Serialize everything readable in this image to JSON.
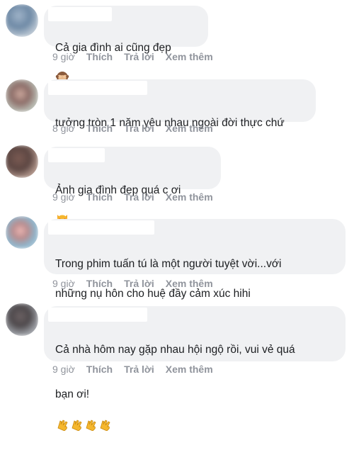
{
  "comments": [
    {
      "text": "Cả gia đình ai cũng đẹp",
      "emoji": "see-no-evil-monkey",
      "time": "9 giờ",
      "like": "Thích",
      "reply": "Trả lời",
      "more": "Xem thêm"
    },
    {
      "text": "tưởng tròn 1 năm yêu nhau ngoài đời thực chứ",
      "time": "8 giờ",
      "like": "Thích",
      "reply": "Trả lời",
      "more": "Xem thêm"
    },
    {
      "text": "Ảnh gia đình đẹp quá c ơi",
      "emoji": "heart-eyes-cat",
      "time": "9 giờ",
      "like": "Thích",
      "reply": "Trả lời",
      "more": "Xem thêm"
    },
    {
      "text_line1": "Trong phim tuấn tú là một người tuyệt vời...với",
      "text_line2": "những nụ hôn cho huệ đầy cảm xúc hihi",
      "time": "9 giờ",
      "like": "Thích",
      "reply": "Trả lời",
      "more": "Xem thêm"
    },
    {
      "text_line1": "Cả nhà hôm nay gặp nhau hội ngộ rồi, vui vẻ quá",
      "text_line2": "bạn ơi!",
      "emoji": "clapping-hands",
      "time": "9 giờ",
      "like": "Thích",
      "reply": "Trả lời",
      "more": "Xem thêm"
    }
  ]
}
